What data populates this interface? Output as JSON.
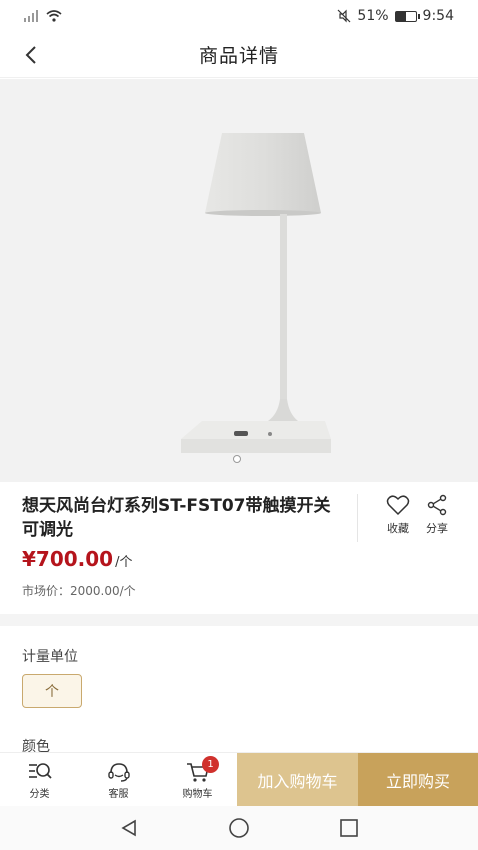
{
  "status_bar": {
    "battery": "51%",
    "time": "9:54",
    "battery_level": 0.51
  },
  "header": {
    "title": "商品详情"
  },
  "product": {
    "title": "想天风尚台灯系列ST-FST07带触摸开关可调光",
    "price": "¥700.00",
    "price_unit": "/个",
    "market_price": "市场价：2000.00/个",
    "carousel_count": 1,
    "actions": [
      {
        "label": "收藏",
        "icon": "heart-icon"
      },
      {
        "label": "分享",
        "icon": "share-icon"
      }
    ]
  },
  "options": {
    "unit_label": "计量单位",
    "unit_value": "个",
    "color_label": "颜色"
  },
  "bottom_bar": {
    "nav": [
      {
        "label": "分类",
        "icon": "category-search-icon"
      },
      {
        "label": "客服",
        "icon": "customer-service-icon"
      },
      {
        "label": "购物车",
        "icon": "cart-icon",
        "badge": "1"
      }
    ],
    "add_to_cart": "加入购物车",
    "buy_now": "立即购买"
  },
  "colors": {
    "price": "#b5141c",
    "gold": "#c8a25b",
    "gold_light": "#ddc48f",
    "badge": "#d0312d"
  }
}
